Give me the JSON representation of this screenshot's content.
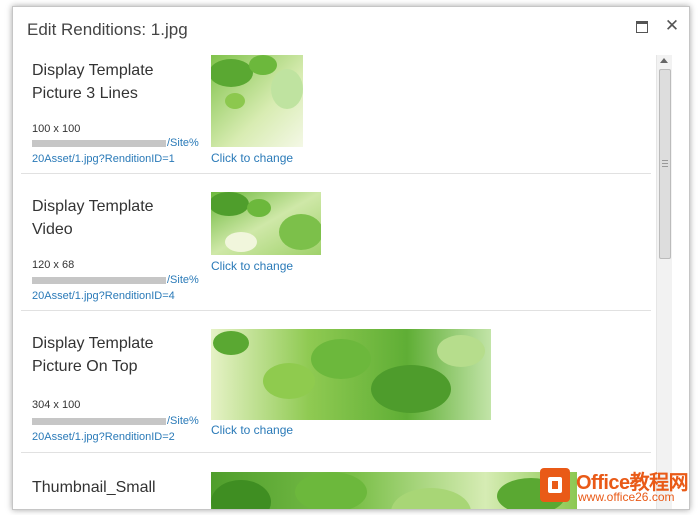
{
  "dialog": {
    "title": "Edit Renditions: 1.jpg",
    "maximize_label": "Maximize",
    "close_symbol": "✕"
  },
  "renditions": [
    {
      "name": "Display Template Picture 3 Lines",
      "dimensions": "100 x 100",
      "url_line1": "/Site%",
      "url_line2": "20Asset/1.jpg?RenditionID=1",
      "change_label": "Click to change"
    },
    {
      "name": "Display Template Video",
      "dimensions": "120 x 68",
      "url_line1": "/Site%",
      "url_line2": "20Asset/1.jpg?RenditionID=4",
      "change_label": "Click to change"
    },
    {
      "name": "Display Template Picture On Top",
      "dimensions": "304 x 100",
      "url_line1": "/Site%",
      "url_line2": "20Asset/1.jpg?RenditionID=2",
      "change_label": "Click to change"
    },
    {
      "name": "Thumbnail_Small"
    }
  ],
  "watermark": {
    "name": "Office教程网",
    "site": "www.office26.com"
  }
}
